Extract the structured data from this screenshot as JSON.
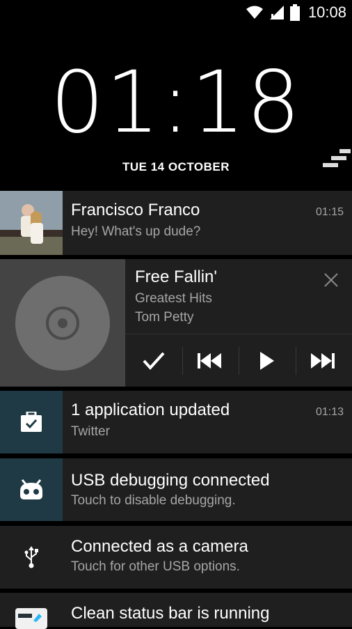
{
  "status_bar": {
    "time": "10:08",
    "icons": [
      "wifi-icon",
      "signal-icon",
      "battery-icon"
    ]
  },
  "lockscreen": {
    "clock": "01:18",
    "date": "TUE 14 OCTOBER"
  },
  "notifications": [
    {
      "id": "message",
      "title": "Francisco Franco",
      "text": "Hey! What's up dude?",
      "time": "01:15",
      "icon": "contact-photo"
    },
    {
      "id": "app-updated",
      "title": "1 application updated",
      "text": "Twitter",
      "time": "01:13",
      "icon": "briefcase-check-icon",
      "icon_bg": "#1f3a45"
    },
    {
      "id": "usb-debug",
      "title": "USB debugging connected",
      "text": "Touch to disable debugging.",
      "icon": "cyanogenmod-bug-icon",
      "icon_bg": "#1f3a45"
    },
    {
      "id": "usb-camera",
      "title": "Connected as a camera",
      "text": "Touch for other USB options.",
      "icon": "usb-icon"
    },
    {
      "id": "clean-status",
      "title": "Clean status bar is running",
      "icon": "app-icon"
    }
  ],
  "media": {
    "track": "Free Fallin'",
    "album": "Greatest Hits",
    "artist": "Tom Petty",
    "controls": [
      "check-icon",
      "previous-icon",
      "play-icon",
      "next-icon"
    ]
  },
  "colors": {
    "background": "#000000",
    "card": "#1f1f1f",
    "accent_icon_bg": "#1f3a45",
    "secondary_text": "#a6a6a6"
  }
}
